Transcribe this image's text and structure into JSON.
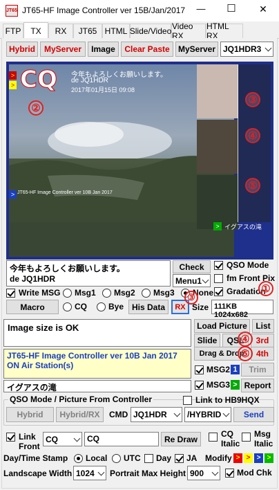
{
  "window": {
    "title": "JT65-HF Image Controller ver 15B/Jan/2017",
    "logo_text": "JT65",
    "minimize": "—",
    "maximize": "☐",
    "close": "✕"
  },
  "tabs": [
    "FTP",
    "TX",
    "RX",
    "JT65",
    "HTML",
    "Slide/Video",
    "Video RX",
    "HTML RX"
  ],
  "active_tab": "TX",
  "toolbar": {
    "hybrid": "Hybrid",
    "myserver_red": "MyServer",
    "image": "Image",
    "clear_paste": "Clear Paste",
    "myserver": "MyServer",
    "server_select": "JQ1HDR3"
  },
  "preview": {
    "cq_text": "CQ",
    "overlay_line1": "今年もよろしくお願いします。",
    "overlay_line2": "de JQ1HDR",
    "overlay_line3": "2017年01月15日 09:08",
    "footer_text": "JT65-HF Image Controller ver 10B Jan 2017",
    "footer_tag": "イグアスの滝",
    "marker_top": ">",
    "marker_top2": ">",
    "marker_left": ">",
    "marker_bottom": ">",
    "circles": [
      "②",
      "③",
      "④",
      "⑤"
    ]
  },
  "message": {
    "line1": "今年もよろしくお願いします。",
    "line2": "de JQ1HDR",
    "check_button": "Check",
    "menu_select": "Menu1",
    "qso_mode": "QSO Mode",
    "fm_front_pix": "fm Front Pix",
    "gradation": "Gradation",
    "gradation_circle": "①"
  },
  "msg_options": {
    "write_msg": "Write MSG",
    "msg1": "Msg1",
    "msg2": "Msg2",
    "msg3": "Msg3",
    "none": "None",
    "macro": "Macro",
    "cq": "CQ",
    "bye": "Bye",
    "his_data": "His Data",
    "rx": "RX",
    "size_label": "Size",
    "size_value": "111KB 1024x682"
  },
  "status": {
    "text": "Image size is OK",
    "load_picture": "Load Picture",
    "list": "List",
    "slide": "Slide",
    "qsl": "QSL",
    "third": "3rd",
    "drag_drop": "Drag & Drop",
    "fourth": "4th",
    "trim": "Trim",
    "msg2": "MSG2",
    "msg2_badge": "1",
    "msg3": "MSG3",
    "msg3_badge": ">",
    "report": "Report",
    "circle4": "④",
    "circle5": "⑤"
  },
  "info": {
    "line1": "JT65-HF Image Controller ver 10B Jan 2017",
    "line2": "ON Air Station(s)",
    "caption": "イグアスの滝"
  },
  "qso": {
    "group_title": "QSO Mode / Picture From Controller",
    "link_hb9": "Link to HB9HQX",
    "hybrid": "Hybrid",
    "hybrid_rx": "Hybrid/RX",
    "cmd": "CMD",
    "cmd_select": "JQ1HDR",
    "mode_select": "/HYBRID",
    "send": "Send"
  },
  "front": {
    "link": "Link",
    "front": "Front",
    "select": "CQ",
    "text": "CQ",
    "re_draw": "Re Draw",
    "cq_italic_1": "CQ",
    "cq_italic_2": "Italic",
    "msg_italic_1": "Msg",
    "msg_italic_2": "Italic"
  },
  "stamp": {
    "label": "Day/Time Stamp",
    "local": "Local",
    "utc": "UTC",
    "day": "Day",
    "ja": "JA",
    "modify": "Modify",
    "swatches": [
      ">",
      ">",
      ">",
      ">"
    ]
  },
  "size": {
    "landscape_label": "Landscape Width",
    "landscape_value": "1024",
    "portrait_label": "Portrait Max Height",
    "portrait_value": "900",
    "mod_chk": "Mod Chk"
  },
  "colors": {
    "accent_red": "#d40000",
    "accent_blue": "#1a3fbf",
    "info_bg": "#ffffc8",
    "preview_border": "#1e2f8c"
  }
}
